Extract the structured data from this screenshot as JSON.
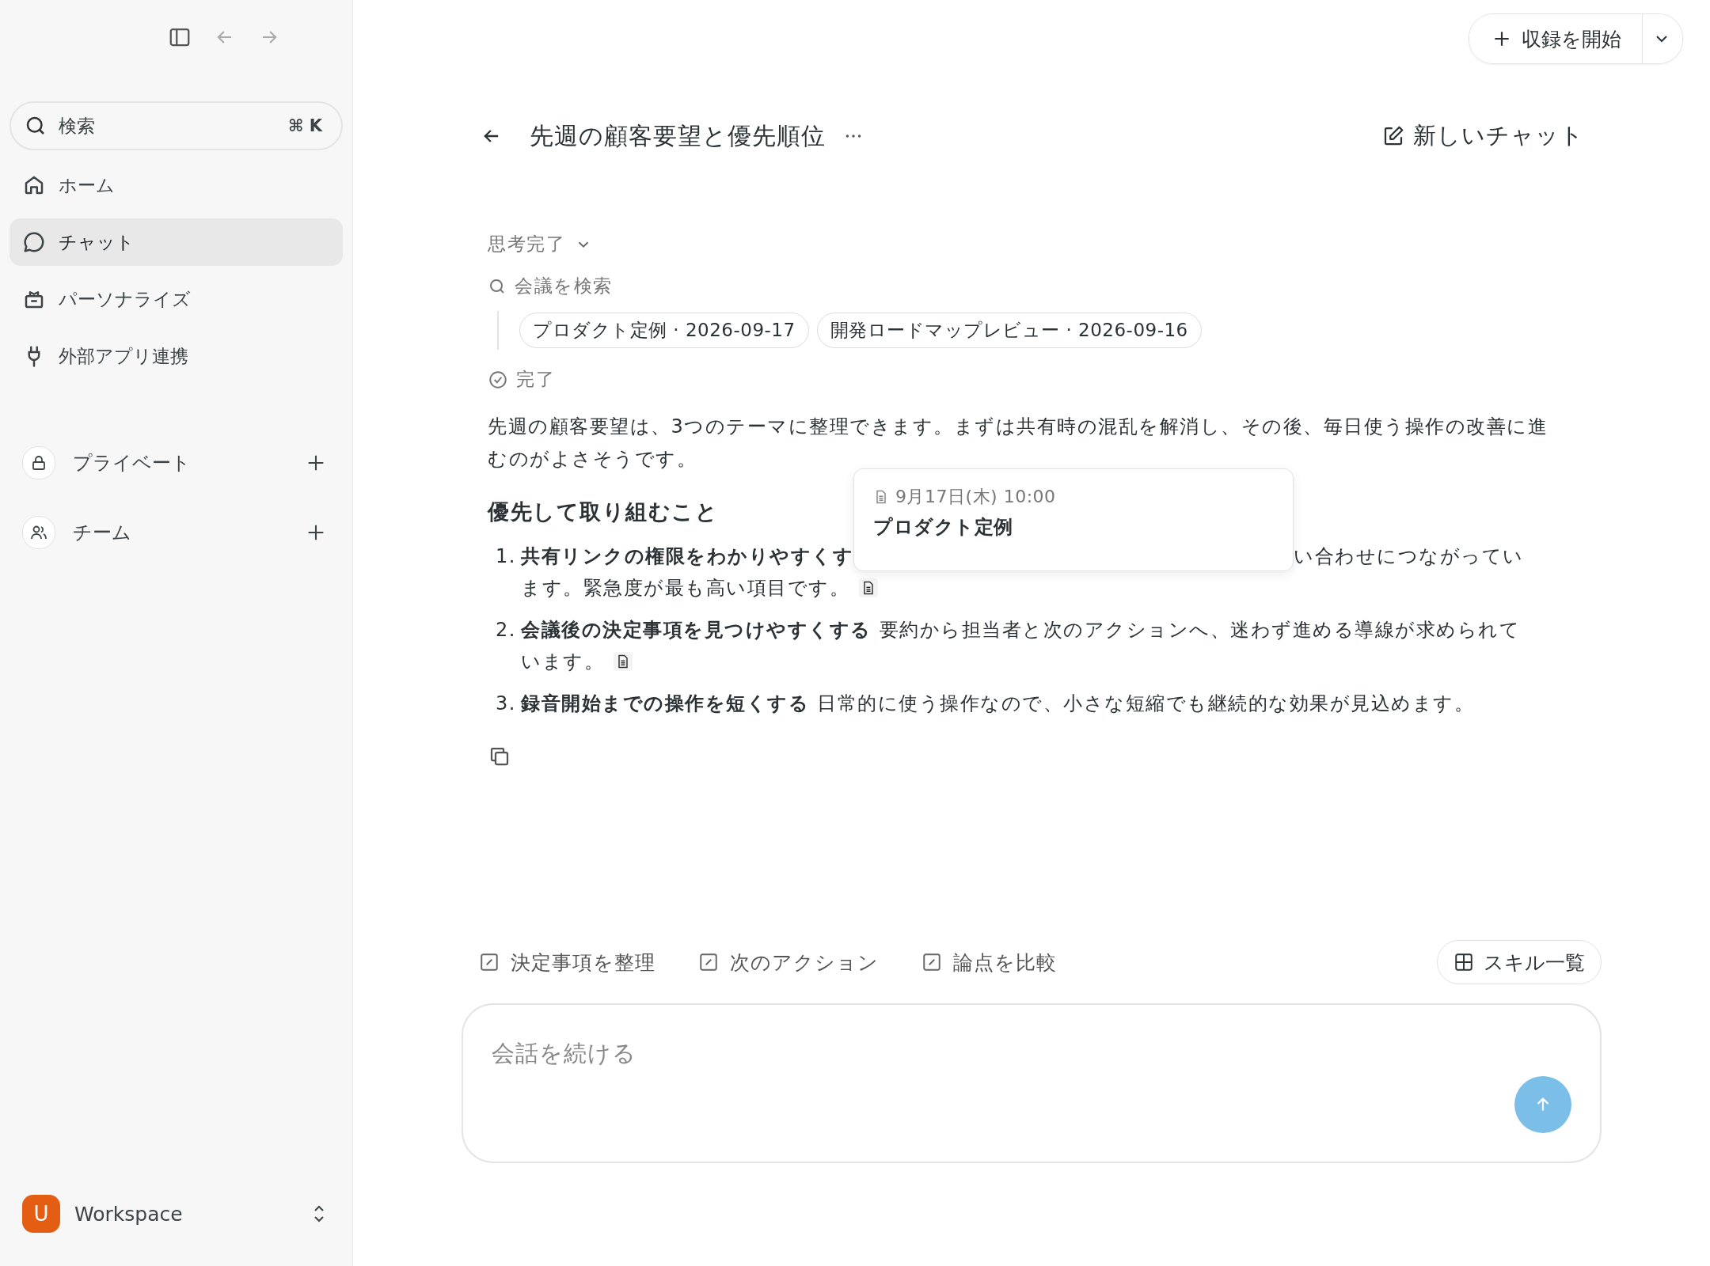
{
  "sidebar": {
    "search": {
      "placeholder": "検索",
      "shortcut": "⌘ K"
    },
    "nav": [
      {
        "label": "ホーム",
        "selected": false
      },
      {
        "label": "チャット",
        "selected": true
      },
      {
        "label": "パーソナライズ",
        "selected": false
      },
      {
        "label": "外部アプリ連携",
        "selected": false
      }
    ],
    "sections": [
      {
        "label": "プライベート"
      },
      {
        "label": "チーム"
      }
    ],
    "workspace": {
      "initial": "U",
      "name": "Workspace"
    }
  },
  "record_button": {
    "label": "収録を開始"
  },
  "chat": {
    "title": "先週の顧客要望と優先順位",
    "new_chat": "新しいチャット",
    "thinking": "思考完了",
    "steps": [
      {
        "kind": "search",
        "label": "会議を検索",
        "sources": [
          "プロダクト定例 · 2026-09-17",
          "開発ロードマップレビュー · 2026-09-16"
        ]
      },
      {
        "kind": "done",
        "label": "完了"
      }
    ],
    "answer": {
      "intro": "先週の顧客要望は、3つのテーマに整理できます。まずは共有時の混乱を解消し、その後、毎日使う操作の改善に進むのがよさそうです。",
      "heading": "優先して取り組むこと",
      "items": [
        {
          "number": "1.",
          "lead": "共有リンクの権限をわかりやすくす",
          "covered": true,
          "body_lines": [
            "い合わせにつながってい",
            "ます。緊急度が最も高い項目です。"
          ],
          "source": true
        },
        {
          "number": "2.",
          "lead": "会議後の決定事項を見つけやすくする",
          "covered": false,
          "body_lines": [
            "要約から担当者と次のアクションへ、迷わず進める導線が求められて",
            "います。"
          ],
          "source": true
        },
        {
          "number": "3.",
          "lead": "録音開始までの操作を短くする",
          "covered": false,
          "body_lines": [
            "日常的に使う操作なので、小さな短縮でも継続的な効果が見込めます。"
          ],
          "source": false
        }
      ],
      "popover": {
        "date": "9月17日(木) 10:00",
        "title": "プロダクト定例"
      }
    }
  },
  "skills": [
    "決定事項を整理",
    "次のアクション",
    "論点を比較"
  ],
  "skills_button": "スキル一覧",
  "composer": {
    "placeholder": "会話を続ける"
  }
}
